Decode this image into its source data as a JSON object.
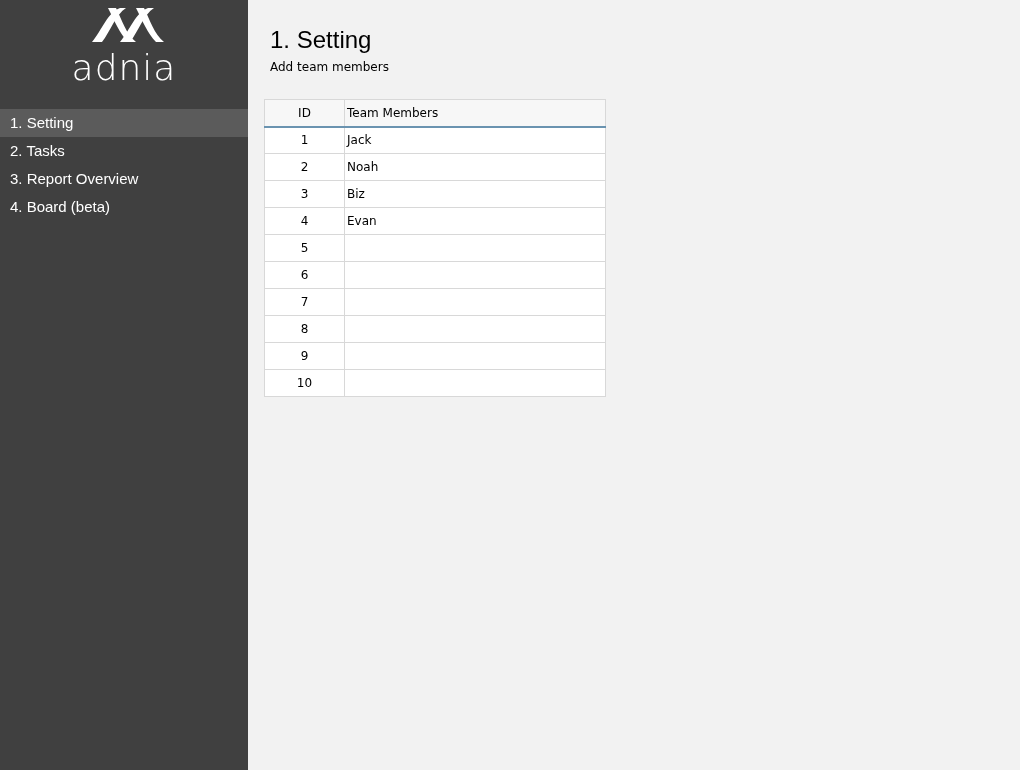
{
  "sidebar": {
    "brand": "adnia",
    "items": [
      {
        "label": "1. Setting",
        "selected": true
      },
      {
        "label": "2. Tasks",
        "selected": false
      },
      {
        "label": "3. Report Overview",
        "selected": false
      },
      {
        "label": "4. Board (beta)",
        "selected": false
      }
    ]
  },
  "page": {
    "title": "1. Setting",
    "subtitle": "Add team members"
  },
  "table": {
    "columns": [
      "ID",
      "Team Members"
    ],
    "rows": [
      {
        "id": "1",
        "member": "Jack"
      },
      {
        "id": "2",
        "member": "Noah"
      },
      {
        "id": "3",
        "member": "Biz"
      },
      {
        "id": "4",
        "member": "Evan"
      },
      {
        "id": "5"
      },
      {
        "id": "6"
      },
      {
        "id": "7"
      },
      {
        "id": "8"
      },
      {
        "id": "9"
      },
      {
        "id": "10"
      }
    ]
  }
}
